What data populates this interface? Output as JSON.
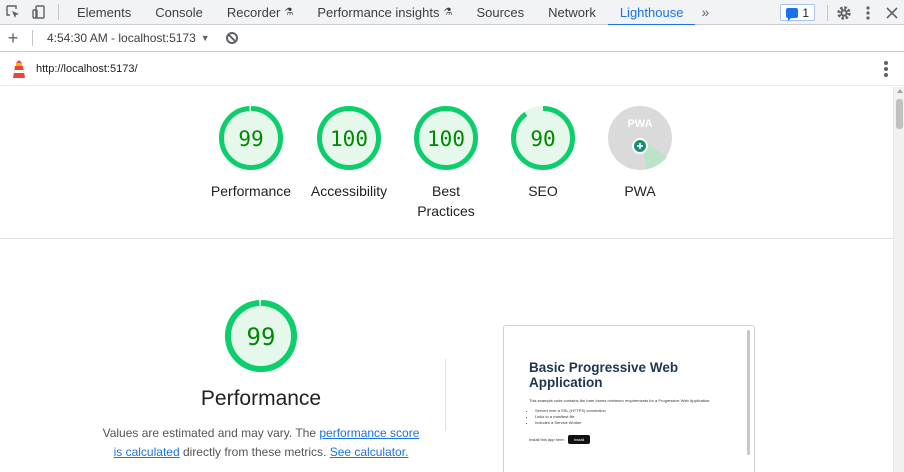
{
  "devtools": {
    "tabs": [
      {
        "label": "Elements"
      },
      {
        "label": "Console"
      },
      {
        "label": "Recorder"
      },
      {
        "label": "Performance insights"
      },
      {
        "label": "Sources"
      },
      {
        "label": "Network"
      },
      {
        "label": "Lighthouse"
      }
    ],
    "active_tab": "Lighthouse",
    "more_tabs": "»",
    "issues_count": "1"
  },
  "toolbar": {
    "report_label": "4:54:30 AM - localhost:5173"
  },
  "urlbar": {
    "url": "http://localhost:5173/"
  },
  "gauges": [
    {
      "score": "99",
      "label": "Performance",
      "value": 99
    },
    {
      "score": "100",
      "label": "Accessibility",
      "value": 100
    },
    {
      "score": "100",
      "label": "Best Practices",
      "value": 100
    },
    {
      "score": "90",
      "label": "SEO",
      "value": 90
    },
    {
      "score": "",
      "label": "PWA",
      "badge": "PWA"
    }
  ],
  "performance": {
    "score": "99",
    "value": 99,
    "title": "Performance",
    "desc_prefix": "Values are estimated and may vary. The ",
    "link1": "performance score is calculated",
    "desc_middle": " directly from these metrics. ",
    "link2": "See calculator."
  },
  "screenshot": {
    "title": "Basic Progressive Web Application",
    "intro": "This example code contains the bare bones minimum requirements for a Progressive Web Application:",
    "items": [
      "Served over a SSL (HTTPS) connection",
      "Links to a manifest file",
      "Includes a Service Worker"
    ],
    "install_label": "Install this app here:",
    "install_button": "Install"
  },
  "colors": {
    "pass": "#0cce6b",
    "pass_text": "#008800",
    "pass_fill": "#e6f7ec",
    "accent": "#1a73e8"
  }
}
